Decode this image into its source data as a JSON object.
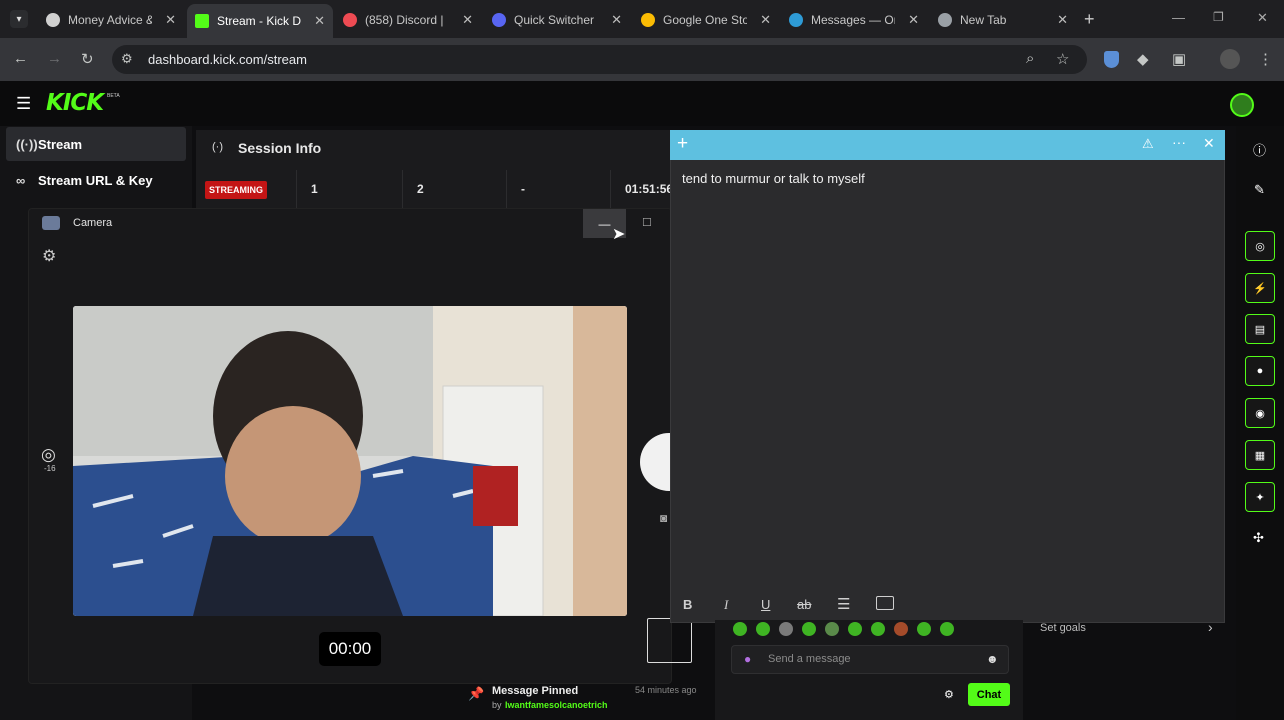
{
  "browser": {
    "tabs": [
      {
        "title": "Money Advice &",
        "fav": "#d0d0d0"
      },
      {
        "title": "Stream - Kick Da",
        "fav": "#53fc18"
      },
      {
        "title": "(858) Discord |",
        "fav": "#ee4b53"
      },
      {
        "title": "Quick Switcher",
        "fav": "#5865f2"
      },
      {
        "title": "Google One Sto",
        "fav": "#fbbc04"
      },
      {
        "title": "Messages — On",
        "fav": "#2e9bd6"
      },
      {
        "title": "New Tab",
        "fav": "#9aa0a6"
      }
    ],
    "url": "dashboard.kick.com/stream"
  },
  "kick": {
    "logo": "KICK",
    "beta": "BETA",
    "sidebar": [
      {
        "label": "Stream",
        "icon": "broadcast-icon"
      },
      {
        "label": "Stream URL & Key",
        "icon": "link-icon"
      }
    ],
    "session": {
      "title": "Session Info",
      "status": "STREAMING",
      "cells": [
        "1",
        "2",
        "-",
        "01:51:56"
      ]
    },
    "camera": {
      "title": "Camera",
      "timer": "00:00",
      "zoom": "-16"
    },
    "note": {
      "text": "tend to murmur or talk to myself"
    },
    "chat": {
      "placeholder": "Send a message",
      "button": "Chat",
      "goals": "Set goals",
      "pinned_title": "Message Pinned",
      "pinned_by": "by",
      "pinned_user": "Iwantfamesolcanoetrich",
      "pinned_time": "54 minutes ago"
    }
  },
  "colors": {
    "accent": "#53fc18",
    "note_header": "#5ec0e0",
    "live": "#c41515"
  }
}
